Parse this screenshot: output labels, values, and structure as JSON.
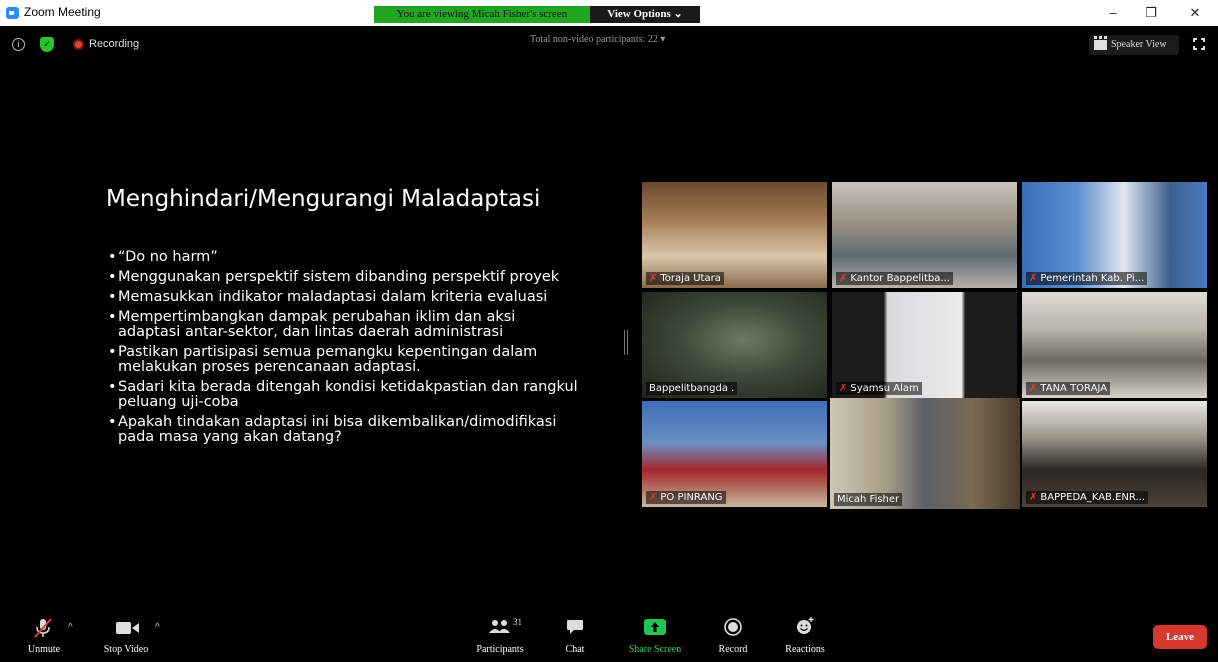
{
  "window": {
    "title": "Zoom Meeting",
    "viewing_banner": "You are viewing Micah Fisher's screen",
    "view_options": "View Options ⌄",
    "minimize": "–",
    "restore": "❐",
    "close": "✕"
  },
  "topbar": {
    "recording_label": "Recording",
    "nonvideo_participants": "Total non-video participants: 22  ▾",
    "speaker_view_label": "Speaker View"
  },
  "slide": {
    "title": "Menghindari/Mengurangi Maladaptasi",
    "bullets": [
      "“Do no harm”",
      "Menggunakan perspektif sistem dibanding perspektif proyek",
      "Memasukkan indikator maladaptasi dalam kriteria evaluasi",
      "Mempertimbangkan dampak perubahan iklim dan aksi adaptasi antar-sektor, dan lintas daerah administrasi",
      "Pastikan partisipasi semua pemangku kepentingan dalam melakukan proses perencanaan adaptasi.",
      "Sadari kita berada ditengah kondisi ketidakpastian dan rangkul peluang uji-coba",
      "Apakah tindakan adaptasi ini bisa dikembalikan/dimodifikasi pada masa yang akan datang?"
    ]
  },
  "participants": [
    {
      "name": "Toraja Utara",
      "muted": true
    },
    {
      "name": "Kantor Bappelitba...",
      "muted": true
    },
    {
      "name": "Pemerintah Kab. Pi...",
      "muted": true
    },
    {
      "name": "Bappelitbangda .",
      "muted": false
    },
    {
      "name": "Syamsu Alam",
      "muted": true
    },
    {
      "name": "TANA TORAJA",
      "muted": true
    },
    {
      "name": "PO PINRANG",
      "muted": true
    },
    {
      "name": "Micah Fisher",
      "muted": false
    },
    {
      "name": "BAPPEDA_KAB.ENR...",
      "muted": true
    }
  ],
  "toolbar": {
    "unmute": "Unmute",
    "stop_video": "Stop Video",
    "participants": "Participants",
    "participants_count": "31",
    "chat": "Chat",
    "share_screen": "Share Screen",
    "record": "Record",
    "reactions": "Reactions",
    "leave": "Leave"
  },
  "colors": {
    "share_green": "#23a524",
    "leave_red": "#d8392e",
    "active_speaker": "#e6e86a",
    "mute_red": "#e53935"
  }
}
